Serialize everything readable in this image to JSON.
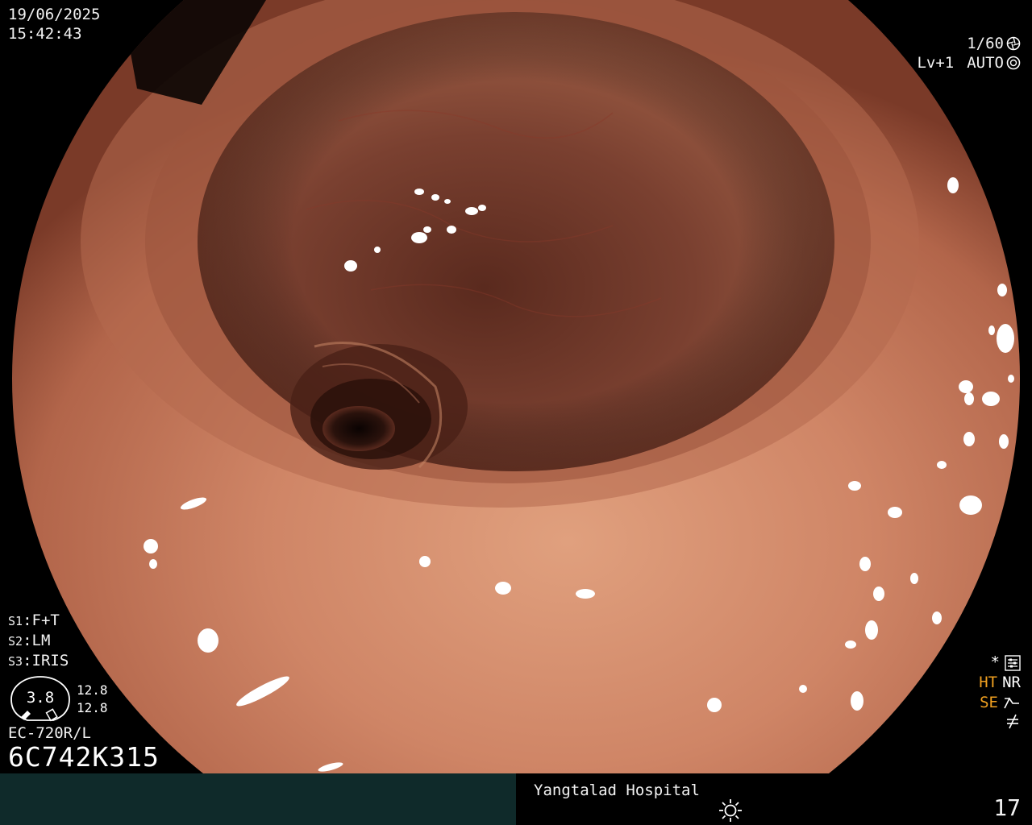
{
  "header": {
    "date": "19/06/2025",
    "time": "15:42:43"
  },
  "exposure": {
    "shutter": "1/60",
    "level": "Lv+1",
    "mode": "AUTO",
    "shutter_icon": "shutter-icon",
    "auto_icon": "auto-iris-icon"
  },
  "settings": {
    "s1_label": "S1",
    "s1_value": ":F+T",
    "s2_label": "S2",
    "s2_value": ":LM",
    "s3_label": "S3",
    "s3_value": ":IRIS"
  },
  "zoom": {
    "value": "3.8",
    "upper": "12.8",
    "lower": "12.8"
  },
  "scope": {
    "model": "EC-720R/L",
    "serial": "6C742K315"
  },
  "status": {
    "star": "*",
    "ht": "HT",
    "nr": "NR",
    "se": "SE",
    "settings_icon": "settings-sliders-icon",
    "se_icon": "se-curve-icon",
    "freeze_icon": "not-equal-icon"
  },
  "footer": {
    "hospital": "Yangtalad Hospital",
    "image_number": "17",
    "light_icon": "sun-icon"
  },
  "colors": {
    "mucosa": "#c97a5a",
    "lumen": "#3a1a12",
    "accent_orange": "#f0a020",
    "bar_teal": "#0f2a2a"
  }
}
